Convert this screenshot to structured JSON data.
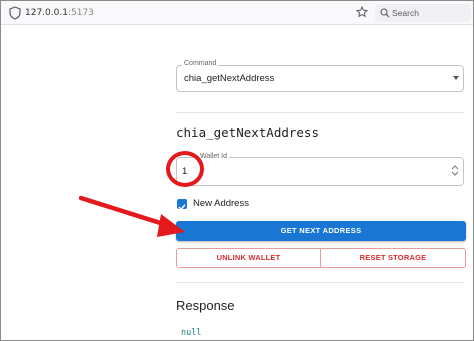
{
  "browser": {
    "url_host": "127.0.0.1",
    "url_port": ":5173",
    "search_placeholder": "Search"
  },
  "command": {
    "label": "Command",
    "value": "chia_getNextAddress"
  },
  "form": {
    "heading": "chia_getNextAddress",
    "wallet_id_label": "Wallet Id",
    "wallet_id_value": "1",
    "new_address_label": "New Address",
    "new_address_checked": true
  },
  "buttons": {
    "submit": "GET NEXT ADDRESS",
    "unlink": "UNLINK WALLET",
    "reset": "RESET STORAGE"
  },
  "response": {
    "title": "Response",
    "value": "null"
  },
  "colors": {
    "primary": "#1976d2",
    "danger": "#d32f2f",
    "annotation": "#e3191b"
  }
}
